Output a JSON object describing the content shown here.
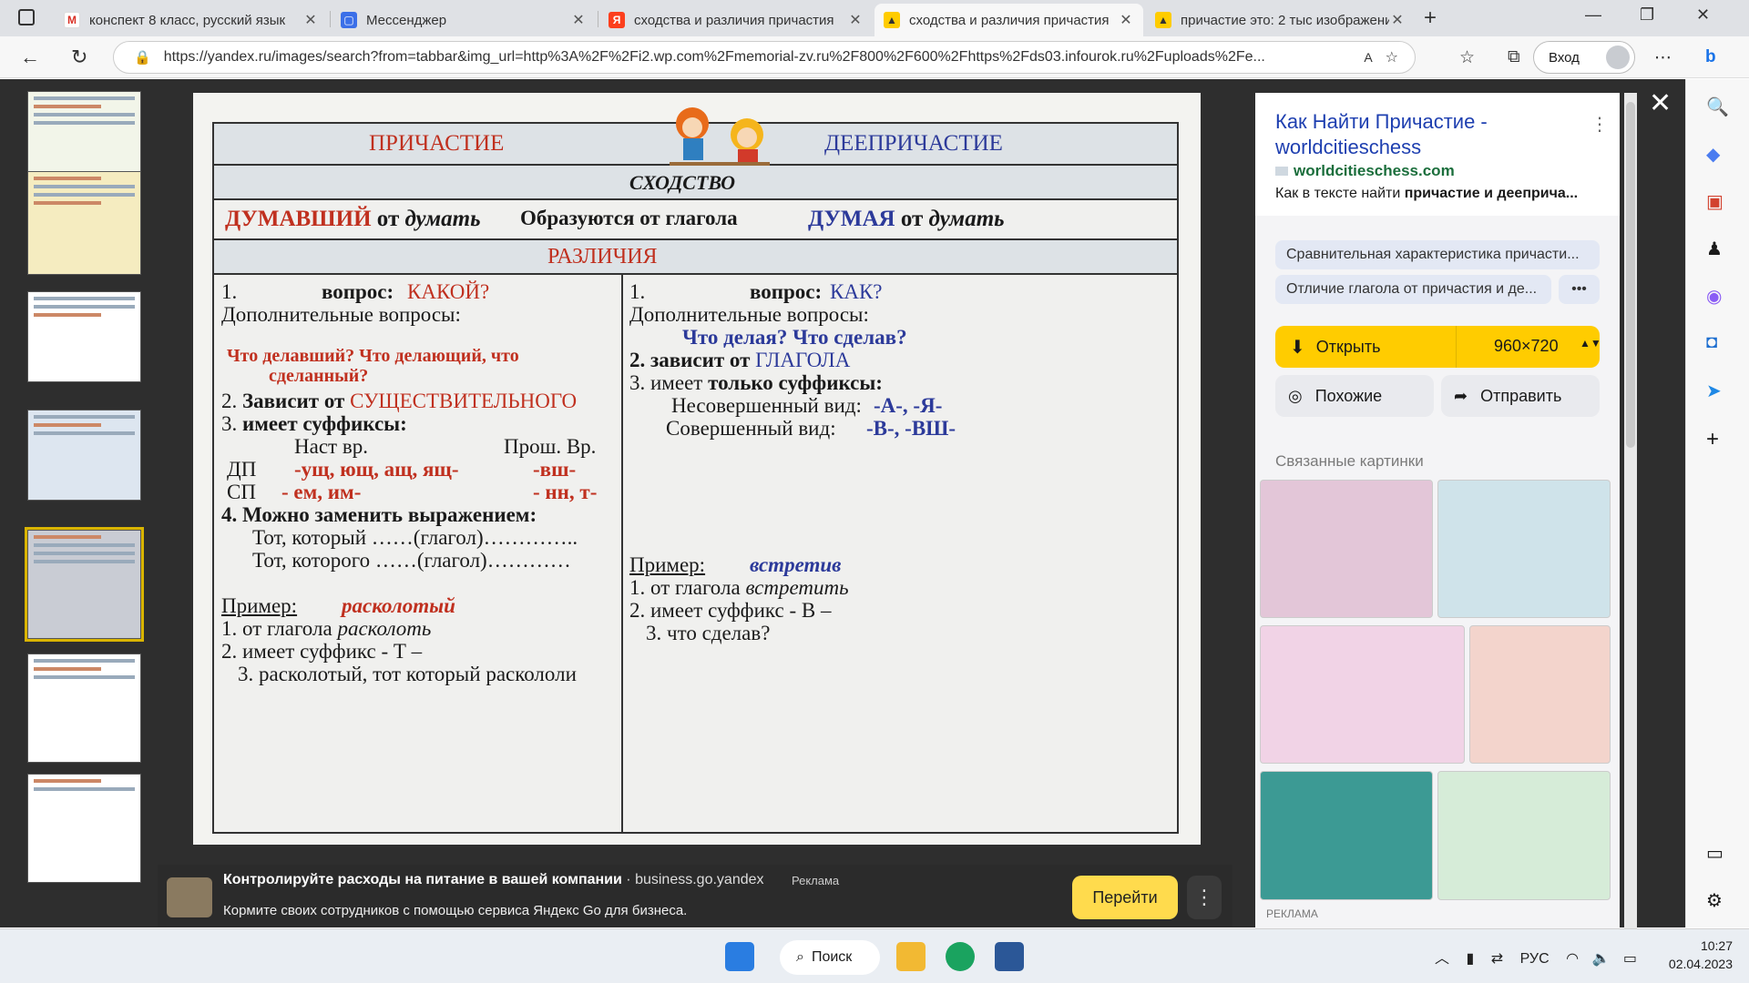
{
  "tabs": [
    {
      "label": "конспект 8 класс, русский язык",
      "icon": "gmail-icon",
      "active": false
    },
    {
      "label": "Мессенджер",
      "icon": "messenger-icon",
      "active": false
    },
    {
      "label": "сходства и различия причастия",
      "icon": "yandex-icon",
      "active": false
    },
    {
      "label": "сходства и различия причастия",
      "icon": "yandex-images-icon",
      "active": true
    },
    {
      "label": "причастие это: 2 тыс изображений",
      "icon": "yandex-images-icon",
      "active": false
    }
  ],
  "url": "https://yandex.ru/images/search?from=tabbar&img_url=http%3A%2F%2Fi2.wp.com%2Fmemorial-zv.ru%2F800%2F600%2Fhttps%2Fds03.infourok.ru%2Fuploads%2Fe...",
  "login_label": "Вход",
  "table": {
    "title_left": "ПРИЧАСТИЕ",
    "title_right": "ДЕЕПРИЧАСТИЕ",
    "similarity": "СХОДСТВО",
    "ex_left_word": "ДУМАВШИЙ",
    "ex_left_rest": " от ",
    "ex_left_verb": "думать",
    "formed": "Образуются от глагола",
    "ex_right_word": "ДУМАЯ",
    "ex_right_rest": " от ",
    "ex_right_verb": "думать",
    "differences": "РАЗЛИЧИЯ",
    "left": {
      "q_num": "1.",
      "q_label": "вопрос:",
      "q_value": "КАКОЙ?",
      "extra": "Дополнительные вопросы:",
      "extra_q1": "Что делавший? Что делающий, что",
      "extra_q2": "сделанный?",
      "dep_pre": "2. ",
      "dep_bold": "Зависит от ",
      "dep_red": "СУЩЕСТВИТЕЛЬНОГО",
      "suf_pre": "3. ",
      "suf_bold": "имеет суффиксы:",
      "present": "Наст вр.",
      "past": "Прош. Вр.",
      "dp": "ДП",
      "dp_present": "-ущ, ющ, ащ, ящ-",
      "dp_past": "-вш-",
      "sp": "СП",
      "sp_present": "- ем, им-",
      "sp_past": "- нн,  т-",
      "replace": "4. Можно заменить выражением:",
      "replace1": "Тот, который  ……(глагол)…………..",
      "replace2": "Тот, которого ……(глагол)…………",
      "example_label": "Пример:",
      "example_word": "расколотый",
      "ex1_pre": "1. от глагола ",
      "ex1_it": "расколоть",
      "ex2": "2. имеет суффикс  - Т –",
      "ex3": "3. расколотый, тот который раскололи"
    },
    "right": {
      "q_num": "1.",
      "q_label": "вопрос:",
      "q_value": "КАК?",
      "extra": "Дополнительные вопросы:",
      "extra_q": "Что делая? Что сделав?",
      "dep": "2. зависит от ",
      "dep_blue": "ГЛАГОЛА",
      "suf_pre": "3. имеет ",
      "suf_bold": "только суффиксы:",
      "imperf": "Несовершенный вид:",
      "imperf_suf": "-А-, -Я-",
      "perf": "Совершенный вид:",
      "perf_suf": "-В-, -ВШ-",
      "example_label": "Пример:",
      "example_word": "встретив",
      "ex1_pre": "1. от глагола ",
      "ex1_it": "встретить",
      "ex2": "2. имеет суффикс  - В –",
      "ex3": "3.  что сделав?"
    }
  },
  "ad": {
    "title": "Контролируйте расходы на питание в вашей компании",
    "domain": " · business.go.yandex",
    "label": "Реклама",
    "text": "Кормите своих сотрудников с помощью сервиса Яндекс Go для бизнеса.",
    "button": "Перейти"
  },
  "side": {
    "title": "Как Найти Причастие - worldcitieschess",
    "domain": "worldcitieschess.com",
    "desc_pre": "Как в тексте найти ",
    "desc_bold": "причастие и дееприча...",
    "chip1": "Сравнительная характеристика причасти...",
    "chip2": "Отличие глагола от причастия и де...",
    "chip_more": "•••",
    "open": "Открыть",
    "size": "960×720",
    "similar": "Похожие",
    "share": "Отправить",
    "related": "Связанные картинки",
    "ad_label": "РЕКЛАМА"
  },
  "taskbar": {
    "search": "Поиск",
    "lang": "РУС",
    "time": "10:27",
    "date": "02.04.2023"
  }
}
